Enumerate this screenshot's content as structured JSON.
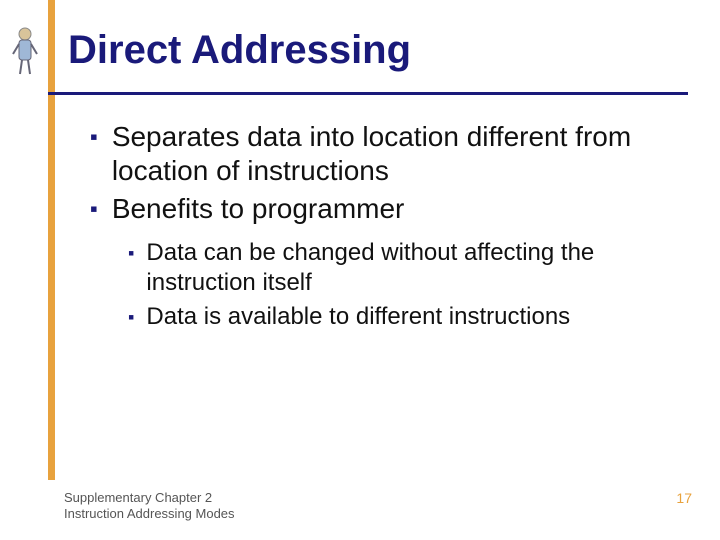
{
  "title": "Direct Addressing",
  "bullets": [
    {
      "text": "Separates data into location different from location of instructions"
    },
    {
      "text": "Benefits to programmer"
    }
  ],
  "subbullets": [
    {
      "text": "Data can be changed without affecting the instruction itself"
    },
    {
      "text": "Data is available to different instructions"
    }
  ],
  "footer": {
    "line1": "Supplementary Chapter 2",
    "line2": "Instruction Addressing Modes"
  },
  "page_number": "17",
  "colors": {
    "accent_bar": "#E8A23D",
    "title_navy": "#1A1A7A"
  }
}
